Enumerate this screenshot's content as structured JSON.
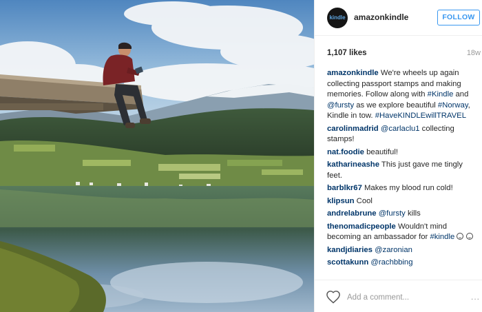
{
  "post": {
    "username": "amazonkindle",
    "avatar_text": "kindle",
    "follow_label": "FOLLOW",
    "likes": "1,107 likes",
    "time_ago": "18w"
  },
  "comments": [
    {
      "user": "amazonkindle",
      "parts": [
        {
          "t": " We're wheels up again collecting passport stamps and making memories. Follow along with "
        },
        {
          "t": "#Kindle",
          "tag": true
        },
        {
          "t": " and "
        },
        {
          "t": "@fursty",
          "tag": true
        },
        {
          "t": " as we explore beautiful "
        },
        {
          "t": "#Norway",
          "tag": true
        },
        {
          "t": ", Kindle in tow. "
        },
        {
          "t": "#HaveKINDLEwillTRAVEL",
          "tag": true
        }
      ]
    },
    {
      "user": "carolinmadrid",
      "parts": [
        {
          "t": " "
        },
        {
          "t": "@carlaclu1",
          "tag": true
        },
        {
          "t": " collecting stamps!"
        }
      ]
    },
    {
      "user": "nat.foodie",
      "parts": [
        {
          "t": " beautiful!"
        }
      ]
    },
    {
      "user": "katharineashe",
      "parts": [
        {
          "t": " This just gave me tingly feet."
        }
      ]
    },
    {
      "user": "barblkr67",
      "parts": [
        {
          "t": " Makes my blood run cold!"
        }
      ]
    },
    {
      "user": "klipsun",
      "parts": [
        {
          "t": " Cool"
        }
      ]
    },
    {
      "user": "andrelabrune",
      "parts": [
        {
          "t": " "
        },
        {
          "t": "@fursty",
          "tag": true
        },
        {
          "t": " kills"
        }
      ]
    },
    {
      "user": "thenomadicpeople",
      "parts": [
        {
          "t": " Wouldn't mind becoming an ambassador for "
        },
        {
          "t": "#kindle",
          "tag": true
        },
        {
          "t": " "
        },
        {
          "emoji": "smile-emoji"
        },
        {
          "t": " "
        },
        {
          "emoji": "smile-emoji"
        }
      ]
    },
    {
      "user": "kandjdiaries",
      "parts": [
        {
          "t": " "
        },
        {
          "t": "@zaronian",
          "tag": true
        }
      ]
    },
    {
      "user": "scottakunn",
      "parts": [
        {
          "t": " "
        },
        {
          "t": "@rachbbing",
          "tag": true
        }
      ]
    }
  ],
  "footer": {
    "comment_placeholder": "Add a comment...",
    "more_label": "..."
  },
  "icons": {
    "like": "heart-icon",
    "more": "more-options-icon"
  },
  "colors": {
    "link": "#003569",
    "follow": "#3897f0",
    "muted": "#999999"
  }
}
